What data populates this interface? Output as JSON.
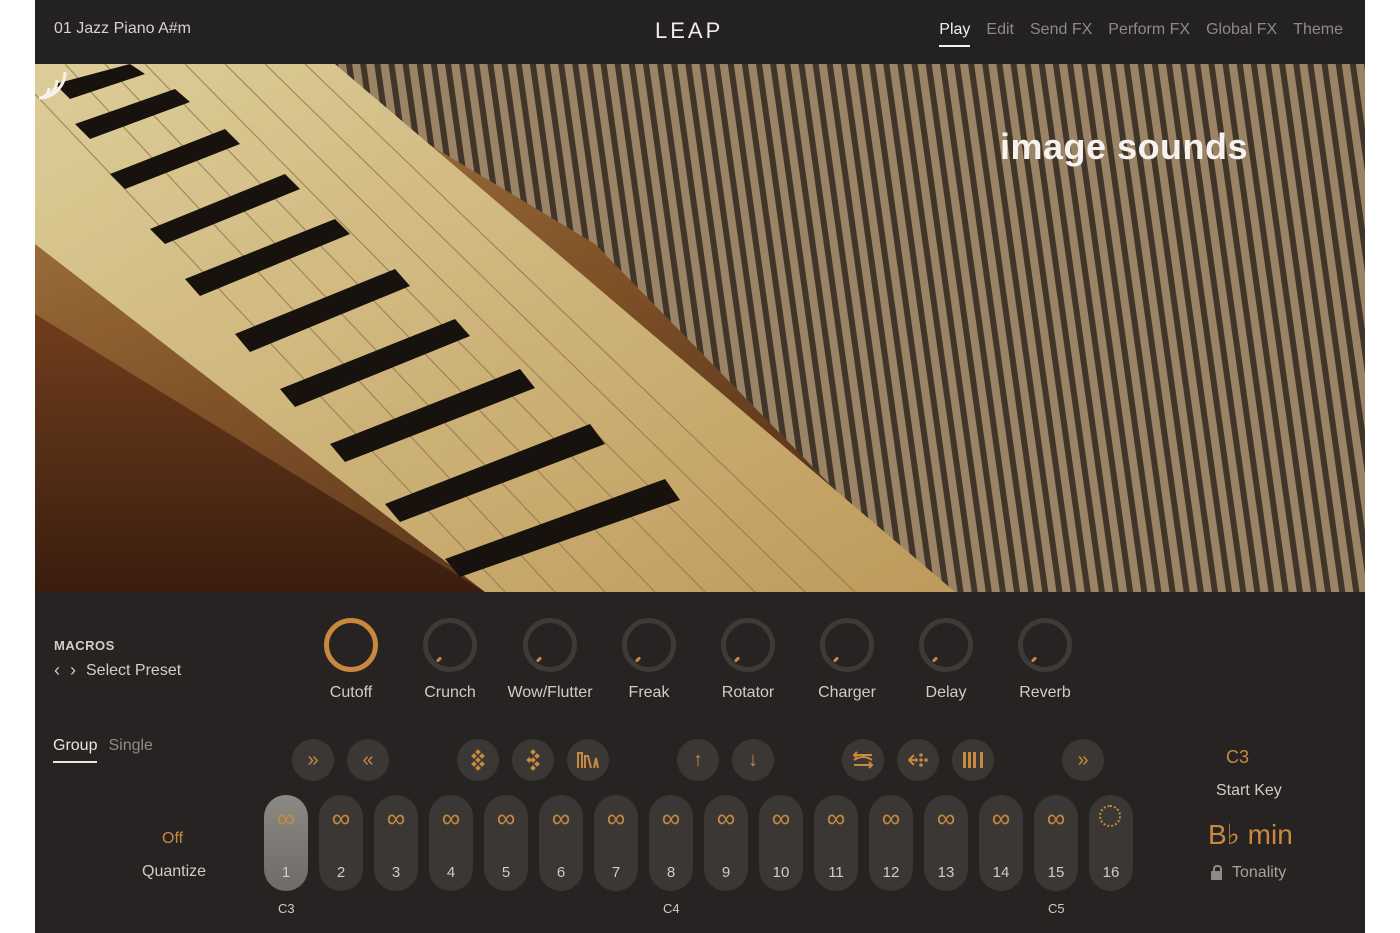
{
  "header": {
    "preset_name": "01 Jazz Piano A#m",
    "logo": "LEAP",
    "tabs": [
      "Play",
      "Edit",
      "Send FX",
      "Perform FX",
      "Global FX",
      "Theme"
    ],
    "active_tab": "Play"
  },
  "hero": {
    "brand": "image sounds"
  },
  "macros": {
    "title": "MACROS",
    "preset_label": "Select Preset",
    "knobs": [
      {
        "label": "Cutoff",
        "active": true
      },
      {
        "label": "Crunch",
        "active": false
      },
      {
        "label": "Wow/Flutter",
        "active": false
      },
      {
        "label": "Freak",
        "active": false
      },
      {
        "label": "Rotator",
        "active": false
      },
      {
        "label": "Charger",
        "active": false
      },
      {
        "label": "Delay",
        "active": false
      },
      {
        "label": "Reverb",
        "active": false
      }
    ]
  },
  "mode": {
    "tabs": [
      "Group",
      "Single"
    ],
    "active": "Group"
  },
  "quantize": {
    "value": "Off",
    "label": "Quantize"
  },
  "controls": {
    "icons": [
      "fast-forward-icon",
      "rewind-icon",
      "diagonal-dots-icon",
      "diagonal-dots-alt-icon",
      "waveform-icon",
      "arrow-up-icon",
      "arrow-down-icon",
      "swap-arrows-icon",
      "dots-arrow-icon",
      "bars-icon",
      "skip-forward-icon"
    ]
  },
  "pads": {
    "numbers": [
      "1",
      "2",
      "3",
      "4",
      "5",
      "6",
      "7",
      "8",
      "9",
      "10",
      "11",
      "12",
      "13",
      "14",
      "15",
      "16"
    ],
    "symbol": "∞",
    "active_pad": "1",
    "octave_labels": [
      "C3",
      "C4",
      "C5"
    ]
  },
  "start_key": {
    "value": "C3",
    "label": "Start Key"
  },
  "tonality": {
    "value": "B♭ min",
    "label": "Tonality"
  },
  "colors": {
    "accent": "#c8893f",
    "background": "#232121",
    "panel": "#262322",
    "text": "#d0ccc6"
  }
}
